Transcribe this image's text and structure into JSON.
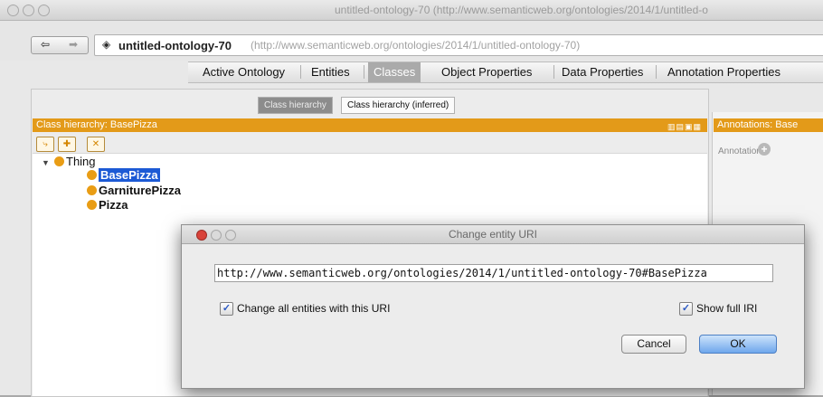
{
  "window": {
    "title": "untitled-ontology-70 (http://www.semanticweb.org/ontologies/2014/1/untitled-o"
  },
  "address": {
    "back_glyph": "⇦",
    "forward_glyph": "➡",
    "ontology_name": "untitled-ontology-70",
    "ontology_url": "(http://www.semanticweb.org/ontologies/2014/1/untitled-ontology-70)"
  },
  "tabs": [
    {
      "label": "Active Ontology"
    },
    {
      "label": "Entities"
    },
    {
      "label": "Classes",
      "active": true
    },
    {
      "label": "Object Properties"
    },
    {
      "label": "Data Properties"
    },
    {
      "label": "Annotation Properties"
    }
  ],
  "subtabs": {
    "class_hierarchy": "Class hierarchy",
    "class_hierarchy_inferred": "Class hierarchy (inferred)"
  },
  "class_panel": {
    "header": "Class hierarchy: BasePizza",
    "header_icons": "▥▤▣▦"
  },
  "tree": {
    "root": "Thing",
    "children": [
      {
        "label": "BasePizza",
        "selected": true
      },
      {
        "label": "GarniturePizza"
      },
      {
        "label": "Pizza"
      }
    ]
  },
  "annotations_panel": {
    "header": "Annotations: Base",
    "label": "Annotations"
  },
  "dialog": {
    "title": "Change entity URI",
    "uri_value": "http://www.semanticweb.org/ontologies/2014/1/untitled-ontology-70#BasePizza",
    "change_all_label": "Change all entities with this URI",
    "change_all_checked": true,
    "show_full_iri_label": "Show full IRI",
    "show_full_iri_checked": true,
    "cancel_label": "Cancel",
    "ok_label": "OK"
  },
  "colors": {
    "accent_orange": "#e39a19",
    "selection_blue": "#1c5ad5",
    "close_red": "#d9433a"
  }
}
